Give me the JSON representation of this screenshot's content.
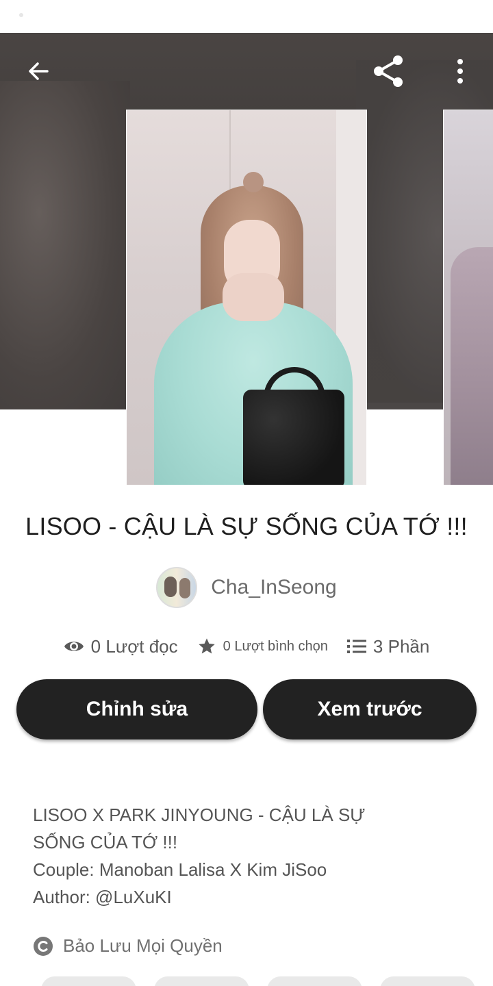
{
  "header": {
    "back_icon": "arrow-left-icon",
    "share_icon": "share-icon",
    "more_icon": "more-vertical-icon"
  },
  "story": {
    "title": "LISOO - CẬU LÀ SỰ SỐNG CỦA TỚ !!!",
    "author": "Cha_InSeong"
  },
  "stats": {
    "reads": "0 Lượt đọc",
    "votes": "0 Lượt bình chọn",
    "parts": "3 Phần"
  },
  "actions": {
    "edit_label": "Chỉnh sửa",
    "preview_label": "Xem trước"
  },
  "description": {
    "lines": [
      "LISOO X PARK JINYOUNG - CẬU LÀ SỰ",
      "SỐNG CỦA TỚ !!!",
      "Couple: Manoban Lalisa X Kim JiSoo",
      "Author: @LuXuKI"
    ]
  },
  "copyright": {
    "label": "Bảo Lưu Mọi Quyền",
    "icon": "copyright-icon"
  },
  "colors": {
    "button_bg": "#222222",
    "button_text": "#ffffff",
    "hero_bg": "#4a4543"
  }
}
